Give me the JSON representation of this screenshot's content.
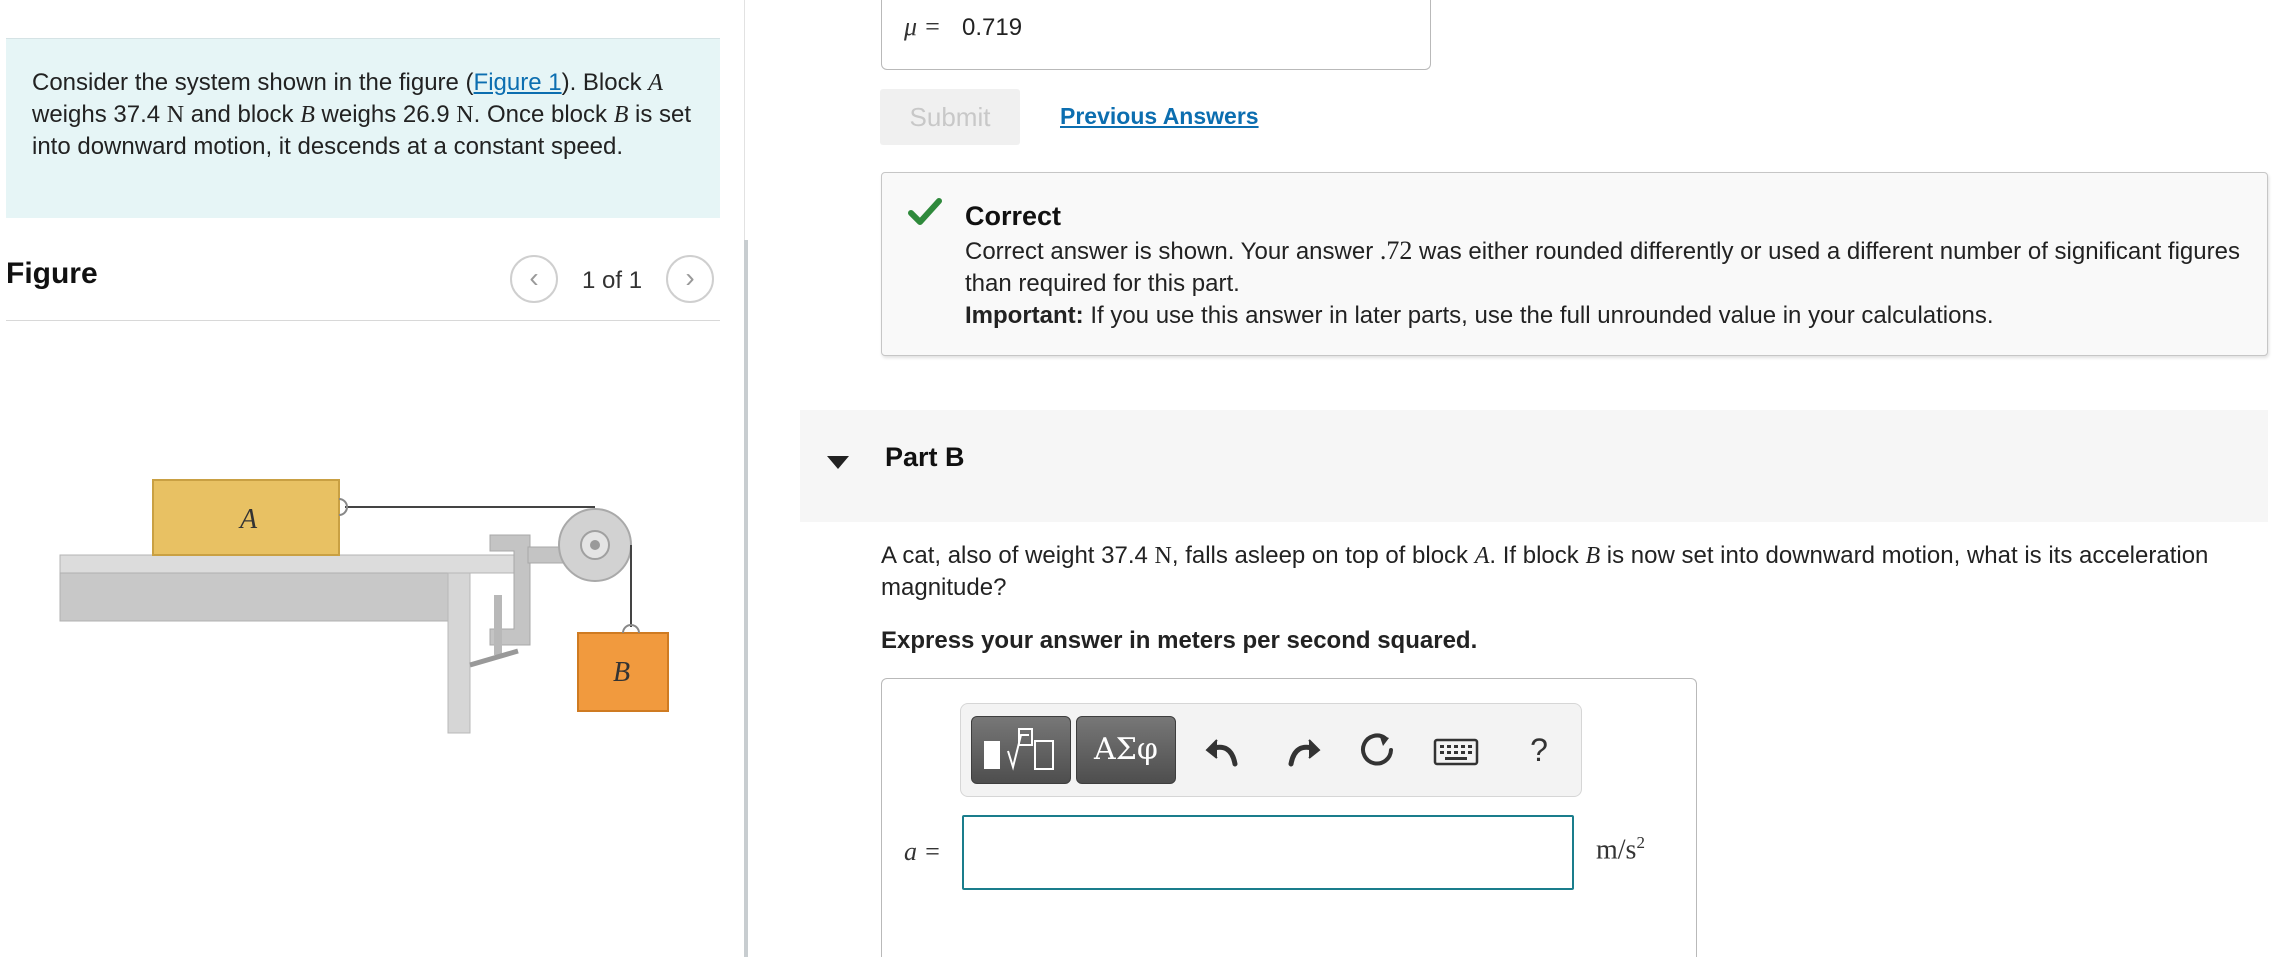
{
  "problem": {
    "intro": "Consider the system shown in the figure (",
    "figure_link": "Figure 1",
    "after_link": "). Block ",
    "block_a": "A",
    "weighs_a": " weighs 37.4 ",
    "unit_n": "N",
    "and_block": " and block ",
    "block_b": "B",
    "weighs_b": " weighs 26.9 ",
    "once_block": ". Once block ",
    "rest": " is set into downward motion, it descends at a constant speed."
  },
  "figure": {
    "title": "Figure",
    "counter": "1 of 1",
    "prev_glyph": "‹",
    "next_glyph": "›",
    "block_a_label": "A",
    "block_b_label": "B",
    "colors": {
      "block_a": "#e8c163",
      "block_b": "#f19a3e",
      "table": "#c8c8c8"
    }
  },
  "part_a": {
    "mu_label": "μ =",
    "mu_value": "0.719",
    "submit_label": "Submit",
    "previous_answers": "Previous Answers",
    "feedback": {
      "title": "Correct",
      "line1_pre": "Correct answer is shown. Your answer ",
      "your_answer": ".72",
      "line1_post": "  was either rounded differently or used a different number of significant figures than required for this part.",
      "important_label": "Important:",
      "important_text": " If you use this answer in later parts, use the full unrounded value in your calculations.",
      "check_color": "#2f8a3c"
    }
  },
  "part_b": {
    "title": "Part B",
    "q_pre": "A cat, also of weight 37.4 ",
    "q_unit": "N",
    "q_mid": ", falls asleep on top of block ",
    "q_block_a": "A",
    "q_mid2": ". If block ",
    "q_block_b": "B",
    "q_post": " is now set into downward motion, what is its acceleration magnitude?",
    "express": "Express your answer in meters per second squared.",
    "toolbar": {
      "symbols_label": "ΑΣφ",
      "help_label": "?"
    },
    "answer_label": "a =",
    "answer_value": "",
    "unit_base": "m/s",
    "unit_exp": "2"
  }
}
